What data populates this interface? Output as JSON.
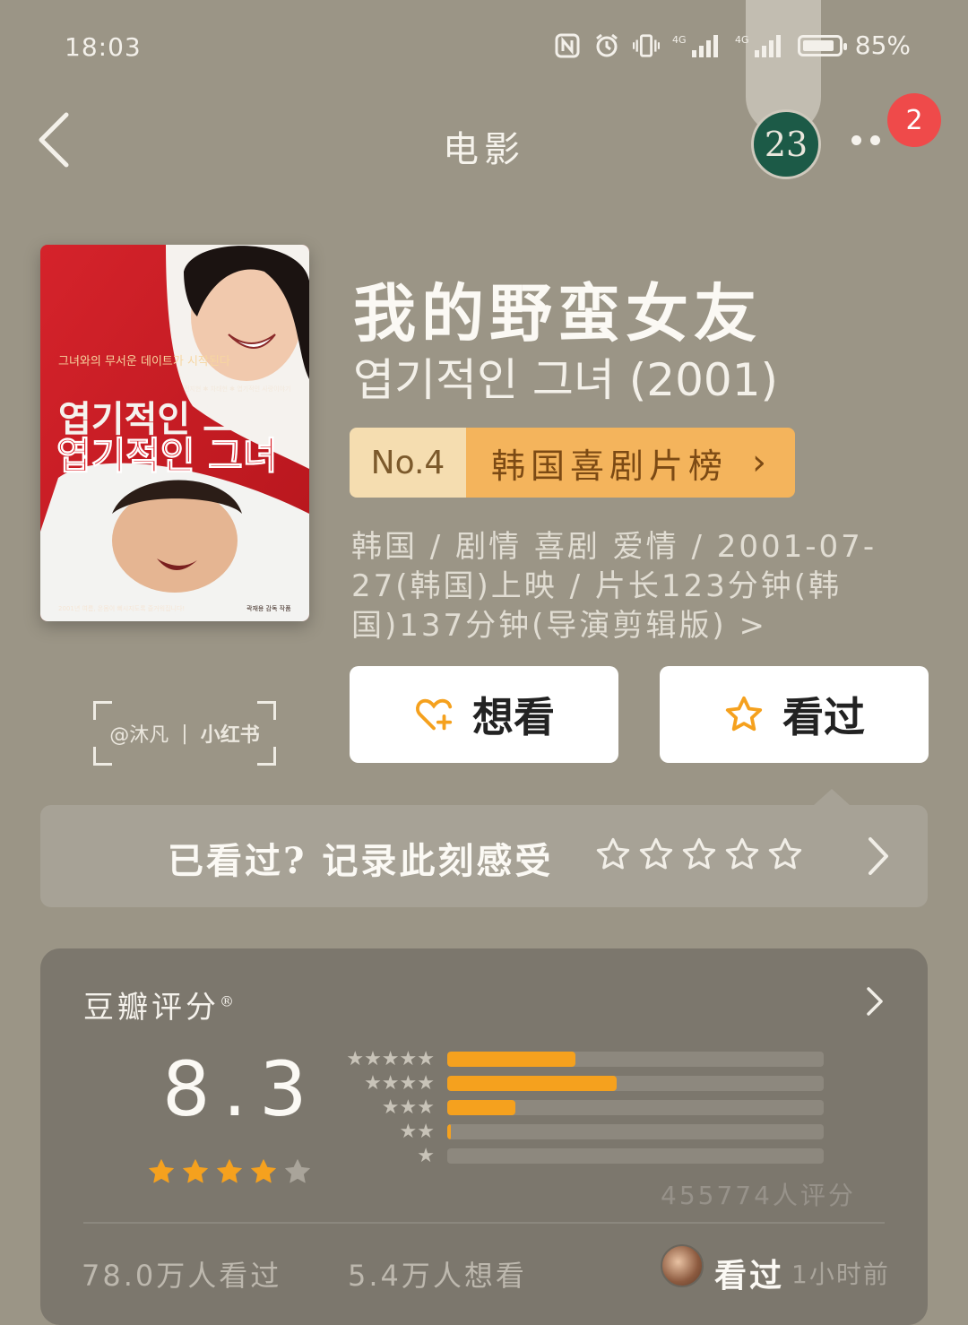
{
  "status_bar": {
    "time": "18:03",
    "battery": "85%",
    "network_1": "4G",
    "network_2": "4G"
  },
  "nav": {
    "title": "电影",
    "avatar_text": "23",
    "notification_count": "2"
  },
  "movie": {
    "title_cn": "我的野蛮女友",
    "title_original": "엽기적인 그녀 (2001)",
    "rank_no": "No.4",
    "rank_list": "韩国喜剧片榜",
    "meta": "韩国 / 剧情 喜剧 爱情 / 2001-07-27(韩国)上映 / 片长123分钟(韩国)137分钟(导演剪辑版) >",
    "poster": {
      "tagline": "그녀와의 무서운 데이트가 시작된다",
      "credits": "전지현 ✱ 차태현 ✱ 엽기적인 사랑이야기",
      "title_top": "엽기적인 그녀",
      "title_red": "엽기적인 그녀",
      "bottom_left": "2001년 여름, 온몸이 뻐시지도록 즐거워집니다!",
      "bottom_right": "곽재용 감독 작품"
    }
  },
  "actions": {
    "want_label": "想看",
    "seen_label": "看过"
  },
  "watermark": {
    "handle": "@沐凡",
    "separator": "|",
    "brand": "小红书"
  },
  "record": {
    "prompt": "已看过? 记录此刻感受",
    "star_count": 5
  },
  "rating": {
    "title": "豆瓣评分",
    "title_mark": "®",
    "score": "8.3",
    "score_stars_filled": 4,
    "score_stars_total": 5,
    "distribution": [
      {
        "stars": 5,
        "fraction": 0.34
      },
      {
        "stars": 4,
        "fraction": 0.45
      },
      {
        "stars": 3,
        "fraction": 0.18
      },
      {
        "stars": 2,
        "fraction": 0.01
      },
      {
        "stars": 1,
        "fraction": 0.0
      }
    ],
    "count": "455774人评分",
    "seen_count": "78.0万人看过",
    "want_count": "5.4万人想看",
    "friend_action": "看过",
    "friend_time": "1小时前"
  },
  "colors": {
    "accent": "#f5a11e",
    "background": "#9b9586",
    "card": "#7c776d",
    "badge": "#ef4a4a"
  }
}
